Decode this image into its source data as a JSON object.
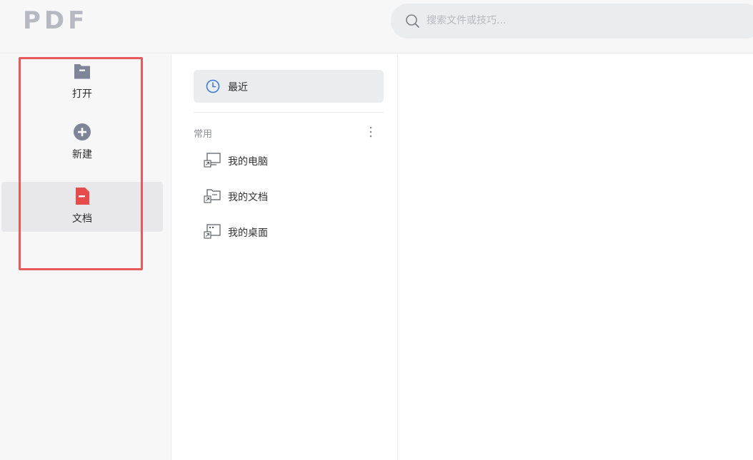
{
  "app": {
    "logo": "PDF"
  },
  "search": {
    "placeholder": "搜索文件或技巧..."
  },
  "sidebar": {
    "items": [
      {
        "label": "打开",
        "icon": "folder-icon",
        "active": false
      },
      {
        "label": "新建",
        "icon": "plus-circle-icon",
        "active": false
      },
      {
        "label": "文档",
        "icon": "document-icon",
        "active": true
      }
    ]
  },
  "nav": {
    "recent_label": "最近",
    "section_title": "常用",
    "places": [
      {
        "label": "我的电脑",
        "icon": "computer-shortcut-icon"
      },
      {
        "label": "我的文档",
        "icon": "documents-folder-shortcut-icon"
      },
      {
        "label": "我的桌面",
        "icon": "desktop-shortcut-icon"
      }
    ]
  },
  "colors": {
    "accent_blue": "#3b7ddd",
    "doc_red": "#e74c4c",
    "icon_gray": "#7d8597",
    "highlight_frame": "#e85a5a",
    "chrome_bg": "#f7f7f8"
  }
}
